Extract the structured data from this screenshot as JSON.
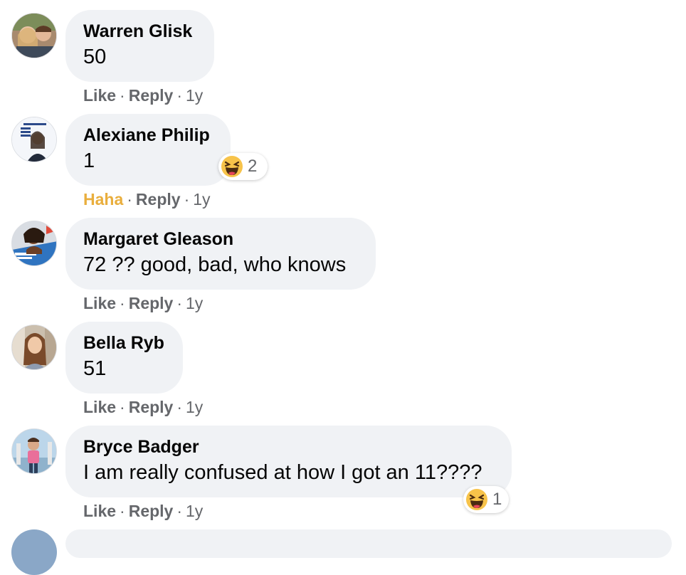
{
  "comments": [
    {
      "author": "Warren Glisk",
      "text": "50",
      "action": "Like",
      "reply": "Reply",
      "time": "1y",
      "avatar_icon": "couple-photo-avatar"
    },
    {
      "author": "Alexiane Philip",
      "text": "1",
      "action": "Haha",
      "reply": "Reply",
      "time": "1y",
      "avatar_icon": "festival-poster-avatar",
      "reaction": {
        "icon": "haha-emoji-icon",
        "count": "2"
      }
    },
    {
      "author": "Margaret Gleason",
      "text": "72 ?? good, bad, who knows",
      "action": "Like",
      "reply": "Reply",
      "time": "1y",
      "avatar_icon": "profile-photo-avatar"
    },
    {
      "author": "Bella Ryb",
      "text": "51",
      "action": "Like",
      "reply": "Reply",
      "time": "1y",
      "avatar_icon": "portrait-photo-avatar"
    },
    {
      "author": "Bryce Badger",
      "text": "I am really confused at how I got an 11????",
      "action": "Like",
      "reply": "Reply",
      "time": "1y",
      "avatar_icon": "outdoor-photo-avatar",
      "reaction": {
        "icon": "haha-emoji-icon",
        "count": "1"
      }
    }
  ],
  "separator": "·",
  "colors": {
    "bubble": "#f0f2f5",
    "meta": "#65676b",
    "haha_active": "#e9ae3d",
    "name": "#050505"
  }
}
